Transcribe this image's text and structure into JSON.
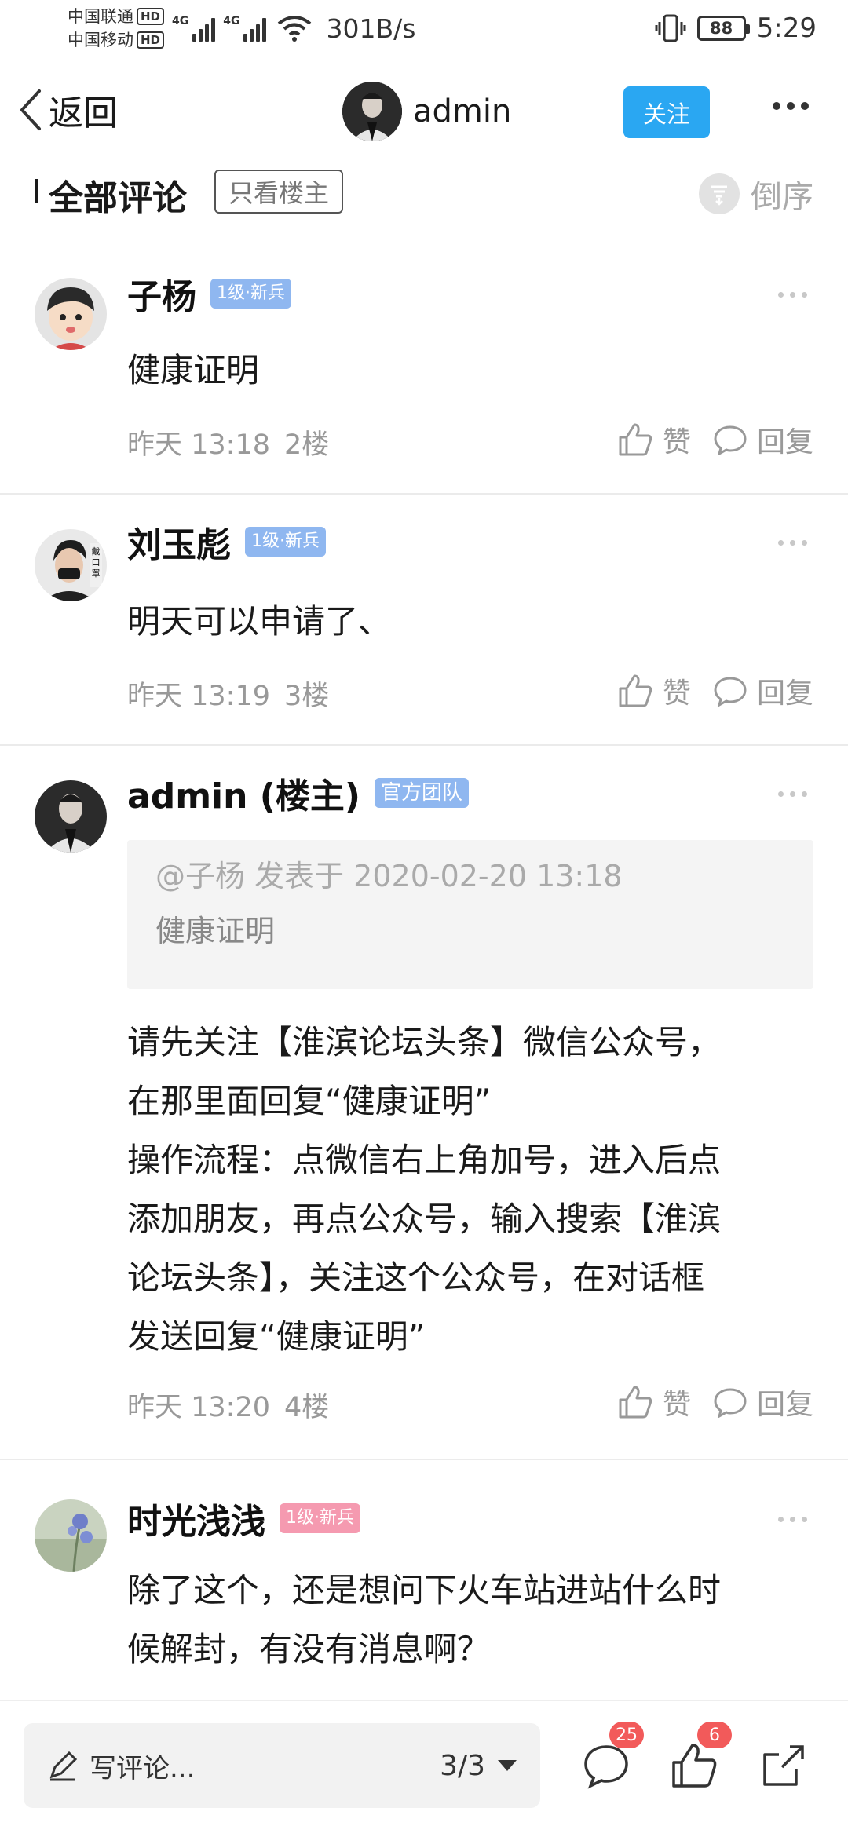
{
  "status_bar": {
    "carrier1": "中国联通",
    "carrier2": "中国移动",
    "hd": "HD",
    "net_type": "4G",
    "net_speed": "301B/s",
    "battery": "88",
    "time": "5:29"
  },
  "nav": {
    "back_label": "返回",
    "title": "admin",
    "follow_label": "关注"
  },
  "section": {
    "title": "全部评论",
    "only_owner": "只看楼主",
    "sort_label": "倒序"
  },
  "comments": [
    {
      "name": "子杨",
      "badge": "1级·新兵",
      "text": "健康证明",
      "time": "昨天 13:18",
      "floor": "2楼",
      "like_label": "赞",
      "reply_label": "回复"
    },
    {
      "name": "刘玉彪",
      "badge": "1级·新兵",
      "text": "明天可以申请了、",
      "time": "昨天 13:19",
      "floor": "3楼",
      "like_label": "赞",
      "reply_label": "回复"
    },
    {
      "name": "admin (楼主)",
      "badge": "官方团队",
      "quote_head": "@子杨 发表于 2020-02-20 13:18",
      "quote_body": "健康证明",
      "text": "请先关注【淮滨论坛头条】微信公众号，\n在那里面回复“健康证明”\n操作流程：点微信右上角加号，进入后点\n添加朋友，再点公众号，输入搜索【淮滨\n论坛头条】，关注这个公众号，在对话框\n发送回复“健康证明”",
      "time": "昨天 13:20",
      "floor": "4楼",
      "like_label": "赞",
      "reply_label": "回复"
    },
    {
      "name": "时光浅浅",
      "badge": "1级·新兵",
      "text": "除了这个，还是想问下火车站进站什么时\n候解封，有没有消息啊？"
    }
  ],
  "bottom": {
    "write_label": "写评论...",
    "page_indicator": "3/3",
    "comment_count": "25",
    "like_count": "6"
  },
  "colors": {
    "accent": "#2aa7f2",
    "badge_blue": "#8fb7f0",
    "badge_pink": "#f59ab0",
    "notify_red": "#f25a5a"
  }
}
